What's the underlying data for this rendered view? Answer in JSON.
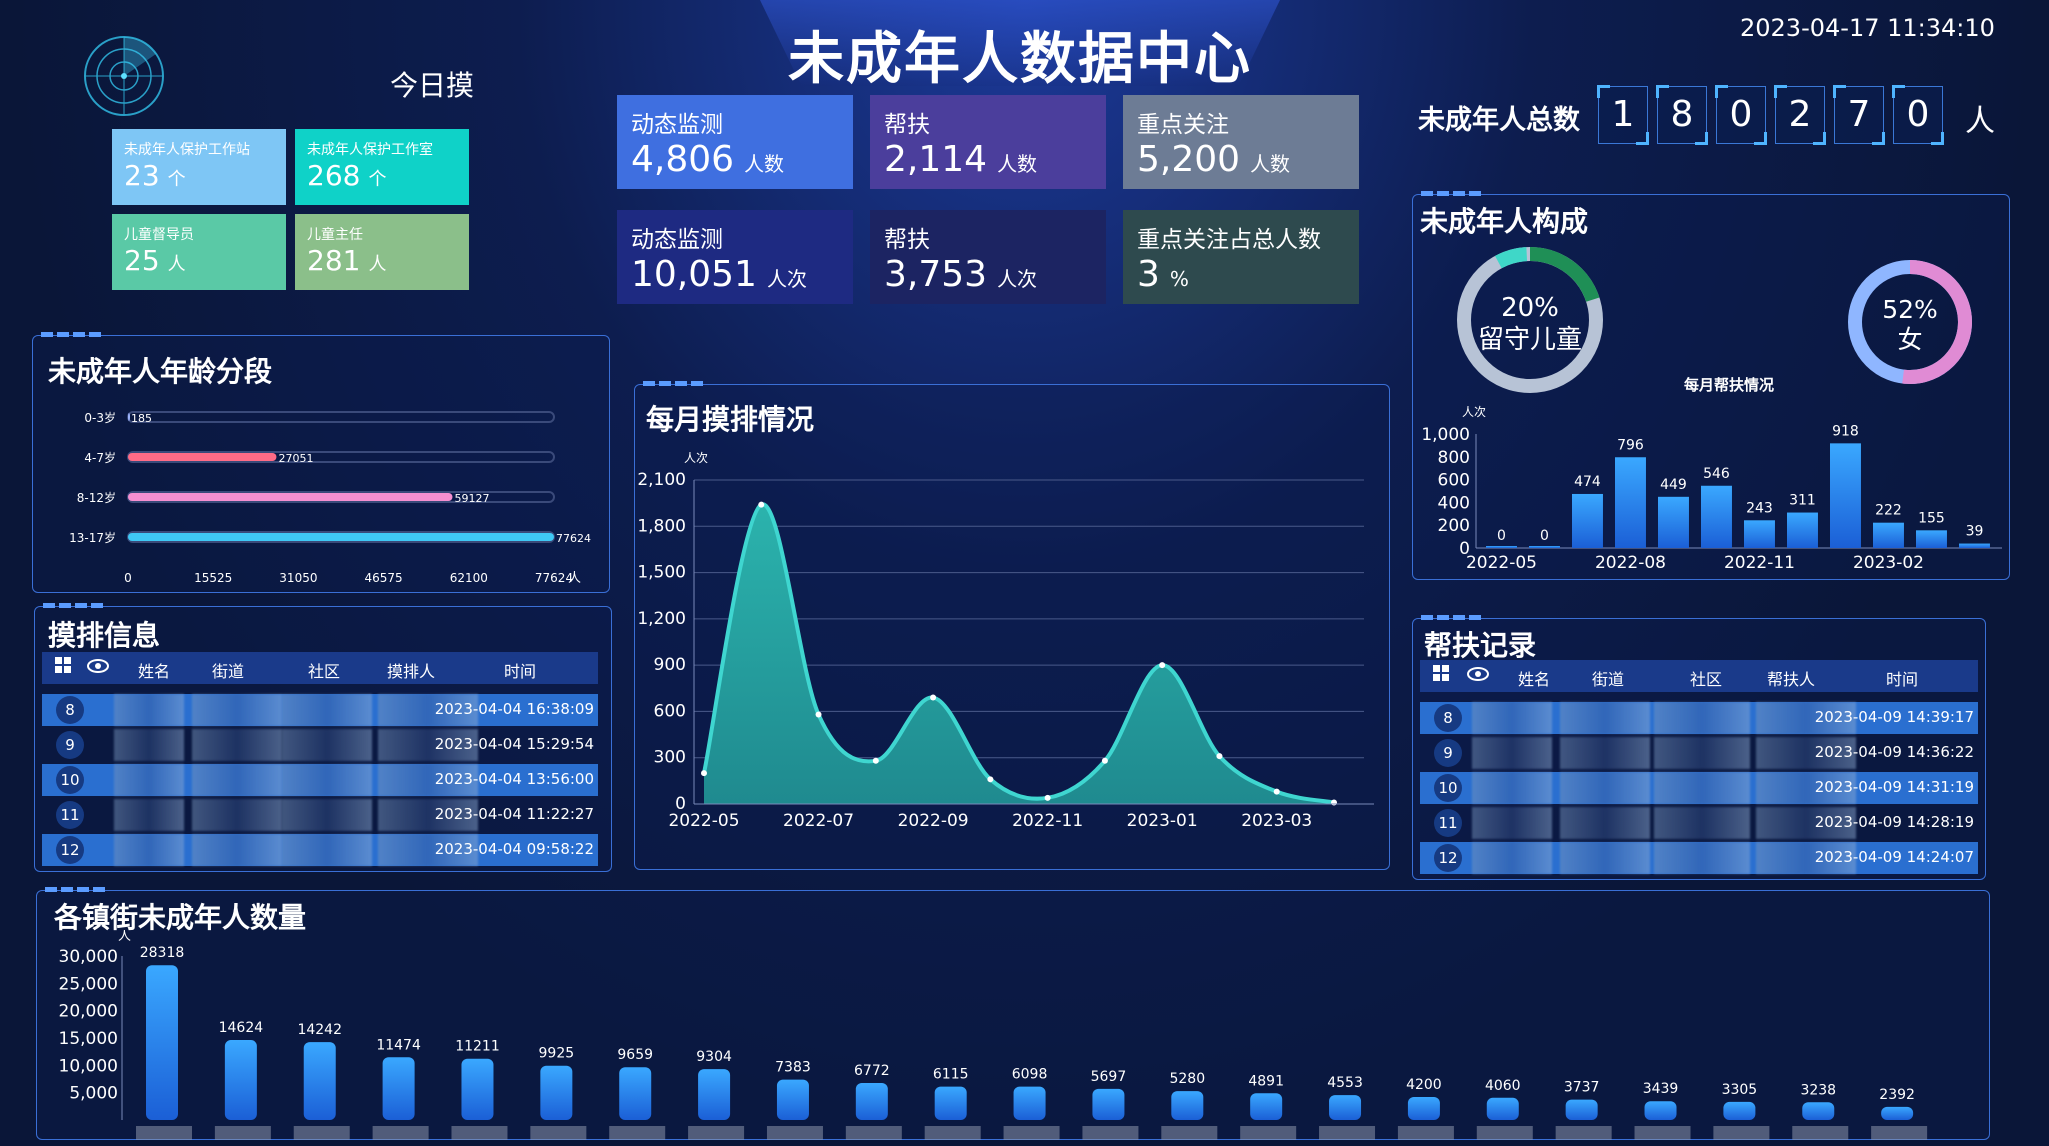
{
  "header": {
    "title": "未成年人数据中心",
    "datetime": "2023-04-17 11:34:10",
    "today_label": "今日摸"
  },
  "tiles": [
    {
      "label": "未成年人保护工作站",
      "value": "23",
      "unit": "个",
      "color": "#7ec6f5"
    },
    {
      "label": "未成年人保护工作室",
      "value": "268",
      "unit": "个",
      "color": "#0fd2c8"
    },
    {
      "label": "儿童督导员",
      "value": "25",
      "unit": "人",
      "color": "#5ac9a6"
    },
    {
      "label": "儿童主任",
      "value": "281",
      "unit": "人",
      "color": "#8bbf8a"
    }
  ],
  "stats": [
    {
      "label": "动态监测",
      "value": "4,806",
      "unit": "人数",
      "color": "#3f6fe0"
    },
    {
      "label": "帮扶",
      "value": "2,114",
      "unit": "人数",
      "color": "#4b3e9c"
    },
    {
      "label": "重点关注",
      "value": "5,200",
      "unit": "人数",
      "color": "#6d7c95"
    },
    {
      "label": "动态监测",
      "value": "10,051",
      "unit": "人次",
      "color": "#1e2a82"
    },
    {
      "label": "帮扶",
      "value": "3,753",
      "unit": "人次",
      "color": "#1c2462"
    },
    {
      "label": "重点关注占总人数",
      "value": "3",
      "unit": "%",
      "color": "#2e4a4e"
    }
  ],
  "total": {
    "label": "未成年人总数",
    "digits": [
      "1",
      "8",
      "0",
      "2",
      "7",
      "0"
    ],
    "unit": "人"
  },
  "age_panel": {
    "title": "未成年人年龄分段",
    "unit": "人",
    "chart_data": {
      "type": "bar",
      "categories": [
        "0-3岁",
        "4-7岁",
        "8-12岁",
        "13-17岁"
      ],
      "values": [
        185,
        27051,
        59127,
        77624
      ],
      "colors": [
        "#9fb6ff",
        "#ff6b86",
        "#f58fd0",
        "#3fc8f5"
      ],
      "xticks": [
        "0",
        "15525",
        "31050",
        "46575",
        "62100",
        "77624"
      ],
      "xlim": [
        0,
        77624
      ]
    }
  },
  "monthly_panel": {
    "title": "每月摸排情况",
    "unit": "人次",
    "chart_data": {
      "type": "area",
      "x": [
        "2022-05",
        "2022-06",
        "2022-07",
        "2022-08",
        "2022-09",
        "2022-10",
        "2022-11",
        "2022-12",
        "2023-01",
        "2023-02",
        "2023-03",
        "2023-04"
      ],
      "values": [
        200,
        1940,
        580,
        280,
        690,
        160,
        40,
        280,
        900,
        310,
        80,
        10
      ],
      "xticks": [
        "2022-05",
        "2022-07",
        "2022-09",
        "2022-11",
        "2023-01",
        "2023-03"
      ],
      "yticks": [
        "0",
        "300",
        "600",
        "900",
        "1,200",
        "1,500",
        "1,800",
        "2,100"
      ],
      "ylim": [
        0,
        2100
      ]
    }
  },
  "composition_panel": {
    "title": "未成年人构成",
    "donut1": {
      "pct": "20%",
      "label": "留守儿童",
      "value": 20
    },
    "donut2": {
      "pct": "52%",
      "label": "女",
      "value": 52
    },
    "subtitle": "每月帮扶情况",
    "unit": "人次",
    "chart_data": {
      "type": "bar",
      "x": [
        "2022-05",
        "2022-06",
        "2022-07",
        "2022-08",
        "2022-09",
        "2022-10",
        "2022-11",
        "2022-12",
        "2023-01",
        "2023-02",
        "2023-03",
        "2023-04"
      ],
      "values": [
        0,
        0,
        474,
        796,
        449,
        546,
        243,
        311,
        918,
        222,
        155,
        39
      ],
      "xticks": [
        "2022-05",
        "2022-08",
        "2022-11",
        "2023-02"
      ],
      "yticks": [
        "0",
        "200",
        "400",
        "600",
        "800",
        "1,000"
      ],
      "ylim": [
        0,
        1000
      ]
    }
  },
  "mopai_table": {
    "title": "摸排信息",
    "headers": [
      "姓名",
      "街道",
      "社区",
      "摸排人",
      "时间"
    ],
    "rows": [
      {
        "idx": "8",
        "time": "2023-04-04 16:38:09"
      },
      {
        "idx": "9",
        "time": "2023-04-04 15:29:54"
      },
      {
        "idx": "10",
        "time": "2023-04-04 13:56:00"
      },
      {
        "idx": "11",
        "time": "2023-04-04 11:22:27"
      },
      {
        "idx": "12",
        "time": "2023-04-04 09:58:22"
      }
    ]
  },
  "help_table": {
    "title": "帮扶记录",
    "headers": [
      "姓名",
      "街道",
      "社区",
      "帮扶人",
      "时间"
    ],
    "rows": [
      {
        "idx": "8",
        "time": "2023-04-09 14:39:17"
      },
      {
        "idx": "9",
        "time": "2023-04-09 14:36:22"
      },
      {
        "idx": "10",
        "time": "2023-04-09 14:31:19"
      },
      {
        "idx": "11",
        "time": "2023-04-09 14:28:19"
      },
      {
        "idx": "12",
        "time": "2023-04-09 14:24:07"
      }
    ]
  },
  "street_panel": {
    "title": "各镇街未成年人数量",
    "unit": "人",
    "chart_data": {
      "type": "bar",
      "values": [
        28318,
        14624,
        14242,
        11474,
        11211,
        9925,
        9659,
        9304,
        7383,
        6772,
        6115,
        6098,
        5697,
        5280,
        4891,
        4553,
        4200,
        4060,
        3737,
        3439,
        3305,
        3238,
        2392
      ],
      "yticks": [
        "5,000",
        "10,000",
        "15,000",
        "20,000",
        "25,000",
        "30,000"
      ],
      "ylim": [
        0,
        30000
      ]
    }
  }
}
